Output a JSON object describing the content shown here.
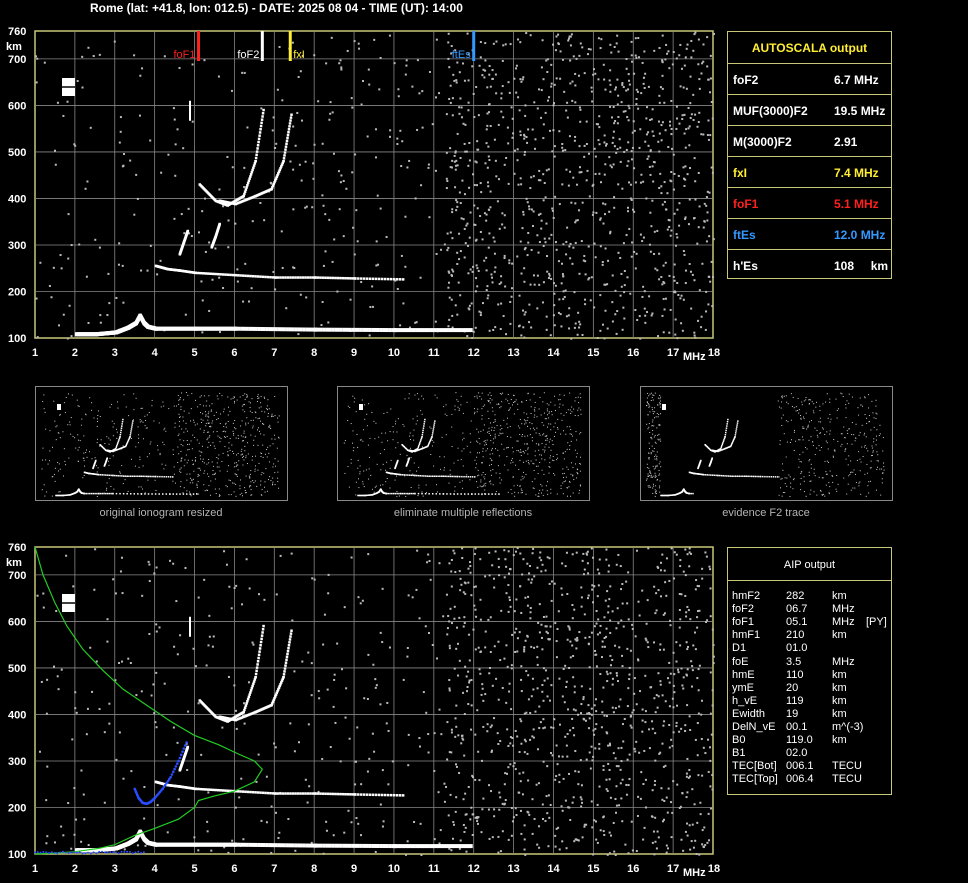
{
  "header": "Rome (lat: +41.8, lon: 012.5) - DATE: 2025 08 04 - TIME (UT): 14:00",
  "colors": {
    "frame": "#c8c878",
    "grid": "#888888",
    "trace": "#ffffff",
    "profile": "#22cc22",
    "blue": "#2a4cff",
    "red": "#ff2020",
    "yellow": "#ffee33",
    "iceblue": "#3399ff"
  },
  "autoscala": {
    "title": "AUTOSCALA output",
    "rows": [
      {
        "label": "foF2",
        "value": "6.7 MHz",
        "color": "#ffffff"
      },
      {
        "label": "MUF(3000)F2",
        "value": "19.5 MHz",
        "color": "#ffffff"
      },
      {
        "label": "M(3000)F2",
        "value": "2.91",
        "color": "#ffffff"
      },
      {
        "label": "fxI",
        "value": "7.4 MHz",
        "color": "#ffee33"
      },
      {
        "label": "foF1",
        "value": "5.1 MHz",
        "color": "#ff2020"
      },
      {
        "label": "ftEs",
        "value": "12.0 MHz",
        "color": "#3399ff"
      },
      {
        "label": "h'Es",
        "value": "108     km",
        "color": "#ffffff"
      }
    ]
  },
  "aip": {
    "title": "AIP output",
    "rows": [
      [
        "hmF2",
        "282",
        "km",
        ""
      ],
      [
        "foF2",
        "06.7",
        "MHz",
        ""
      ],
      [
        "foF1",
        "05.1",
        "MHz",
        "[PY]"
      ],
      [
        "hmF1",
        "210",
        "km",
        ""
      ],
      [
        "D1",
        "01.0",
        "",
        ""
      ],
      [
        "foE",
        "3.5",
        "MHz",
        ""
      ],
      [
        "hmE",
        "110",
        "km",
        ""
      ],
      [
        "ymE",
        "20",
        "km",
        ""
      ],
      [
        "h_vE",
        "119",
        "km",
        ""
      ],
      [
        "Ewidth",
        "19",
        "km",
        ""
      ],
      [
        "DelN_vE",
        "00.1",
        "m^(-3)",
        ""
      ],
      [
        "B0",
        "119.0",
        "km",
        ""
      ],
      [
        "B1",
        "02.0",
        "",
        ""
      ],
      [
        "TEC[Bot]",
        "006.1",
        "TECU",
        ""
      ],
      [
        "TEC[Top]",
        "006.4",
        "TECU",
        ""
      ]
    ]
  },
  "captions": [
    "original ionogram resized",
    "eliminate multiple reflections",
    "evidence F2 trace"
  ],
  "chart_data": [
    {
      "type": "scatter",
      "xlabel": "MHz",
      "ylabel": "km",
      "xlim": [
        1,
        18
      ],
      "ylim": [
        100,
        760
      ],
      "xticks": [
        "1",
        "2",
        "3",
        "4",
        "5",
        "6",
        "7",
        "8",
        "9",
        "10",
        "11",
        "12",
        "13",
        "14",
        "15",
        "16",
        "17",
        "18"
      ],
      "yticks": [
        "100",
        "200",
        "300",
        "400",
        "500",
        "600",
        "700",
        "760"
      ],
      "grid": true,
      "markers": [
        {
          "name": "foF1",
          "x": 5.1,
          "color": "#ff2020"
        },
        {
          "name": "foF2",
          "x": 6.7,
          "color": "#ffffff"
        },
        {
          "name": "fxI",
          "x": 7.4,
          "color": "#ffee33"
        },
        {
          "name": "ftEs",
          "x": 12.0,
          "color": "#3399ff"
        }
      ],
      "traces": [
        {
          "kind": "Es",
          "x": [
            2.0,
            2.5,
            3.0,
            3.3,
            3.5,
            3.6,
            3.7,
            3.8,
            4,
            5,
            6,
            8,
            10,
            11.9
          ],
          "y": [
            108,
            108,
            112,
            122,
            132,
            148,
            132,
            124,
            120,
            120,
            120,
            118,
            117,
            117
          ]
        },
        {
          "kind": "E",
          "x": [
            4.0,
            4.3,
            4.6,
            5.0,
            6,
            7,
            8,
            9,
            10.2
          ],
          "y": [
            255,
            248,
            245,
            240,
            235,
            230,
            230,
            228,
            226
          ]
        },
        {
          "kind": "F1",
          "x": [
            4.6,
            4.7,
            4.8
          ],
          "y": [
            280,
            305,
            330
          ]
        },
        {
          "kind": "F1b",
          "x": [
            5.4,
            5.5,
            5.6
          ],
          "y": [
            295,
            318,
            345
          ]
        },
        {
          "kind": "F2o",
          "x": [
            5.1,
            5.5,
            5.8,
            6.2,
            6.5,
            6.7
          ],
          "y": [
            430,
            395,
            385,
            405,
            480,
            590
          ]
        },
        {
          "kind": "F2x",
          "x": [
            5.6,
            6,
            6.5,
            6.9,
            7.2,
            7.4
          ],
          "y": [
            395,
            388,
            405,
            420,
            480,
            580
          ]
        }
      ]
    },
    {
      "type": "line",
      "xlabel": "MHz",
      "ylabel": "km",
      "xlim": [
        1,
        18
      ],
      "ylim": [
        100,
        760
      ],
      "xticks": [
        "1",
        "2",
        "3",
        "4",
        "5",
        "6",
        "7",
        "8",
        "9",
        "10",
        "11",
        "12",
        "13",
        "14",
        "15",
        "16",
        "17",
        "18"
      ],
      "yticks": [
        "100",
        "200",
        "300",
        "400",
        "500",
        "600",
        "700",
        "760"
      ],
      "grid": true,
      "profile": {
        "x": [
          1.0,
          1.2,
          1.5,
          1.8,
          2.2,
          2.7,
          3.2,
          3.8,
          4.4,
          5.0,
          5.6,
          6.1,
          6.5,
          6.7,
          6.5,
          6.0,
          5.5,
          5.1,
          5.0,
          4.6,
          4.0,
          3.5,
          3.2,
          3.0,
          2.6,
          2.0,
          1.5,
          1.0
        ],
        "y": [
          760,
          700,
          640,
          590,
          540,
          495,
          455,
          420,
          385,
          355,
          335,
          315,
          300,
          282,
          255,
          235,
          225,
          215,
          200,
          175,
          155,
          140,
          128,
          120,
          112,
          105,
          102,
          100
        ]
      },
      "blue_trace": {
        "x": [
          3.5,
          3.6,
          3.7,
          3.8,
          3.9,
          4.0,
          4.2,
          4.4,
          4.6,
          4.8
        ],
        "y": [
          240,
          220,
          210,
          208,
          212,
          220,
          240,
          265,
          300,
          340
        ]
      },
      "traces": [
        {
          "kind": "Es",
          "x": [
            2.0,
            2.5,
            3.0,
            3.3,
            3.5,
            3.6,
            3.7,
            3.8,
            4,
            5,
            6,
            8,
            10,
            11.9
          ],
          "y": [
            108,
            108,
            112,
            122,
            132,
            148,
            132,
            124,
            120,
            120,
            120,
            118,
            117,
            117
          ]
        },
        {
          "kind": "E",
          "x": [
            4.0,
            4.3,
            4.6,
            5.0,
            6,
            7,
            8,
            9,
            10.2
          ],
          "y": [
            255,
            248,
            245,
            240,
            235,
            230,
            230,
            228,
            226
          ]
        },
        {
          "kind": "F1",
          "x": [
            4.6,
            4.7,
            4.8
          ],
          "y": [
            280,
            305,
            330
          ]
        },
        {
          "kind": "F2o",
          "x": [
            5.1,
            5.5,
            5.8,
            6.2,
            6.5,
            6.7
          ],
          "y": [
            430,
            395,
            385,
            405,
            480,
            590
          ]
        },
        {
          "kind": "F2x",
          "x": [
            5.6,
            6,
            6.5,
            6.9,
            7.2,
            7.4
          ],
          "y": [
            395,
            388,
            405,
            420,
            480,
            580
          ]
        }
      ]
    }
  ]
}
